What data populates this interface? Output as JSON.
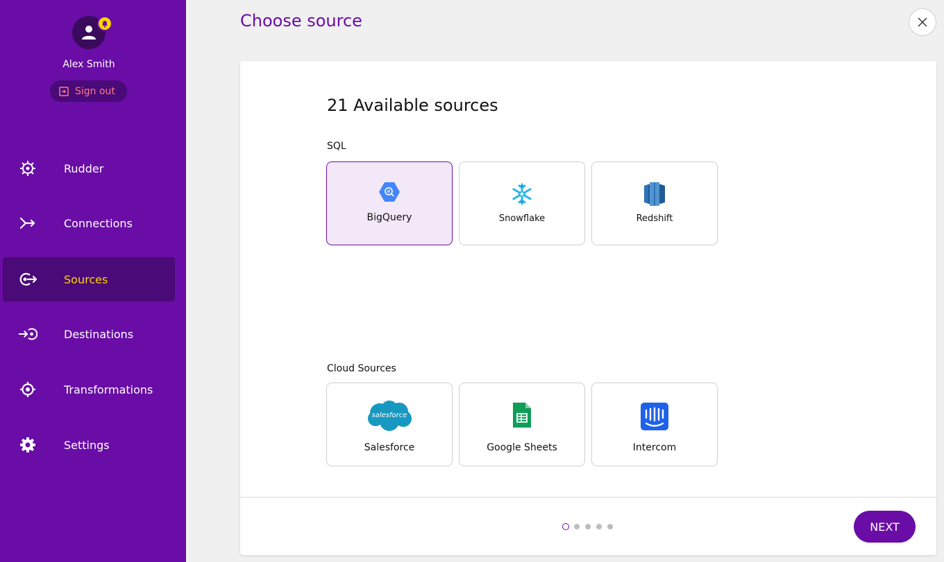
{
  "sidebar": {
    "user_name": "Alex Smith",
    "signout_label": "Sign out",
    "items": [
      {
        "label": "Rudder",
        "icon": "wheel-icon"
      },
      {
        "label": "Connections",
        "icon": "merge-arrow-icon"
      },
      {
        "label": "Sources",
        "icon": "source-icon"
      },
      {
        "label": "Destinations",
        "icon": "destination-icon"
      },
      {
        "label": "Transformations",
        "icon": "target-icon"
      },
      {
        "label": "Settings",
        "icon": "gear-icon"
      }
    ],
    "active_item": "Sources"
  },
  "header": {
    "title": "Choose source"
  },
  "main": {
    "heading": "21 Available sources",
    "sections": [
      {
        "label": "SQL",
        "tiles": [
          {
            "label": "BigQuery",
            "icon": "bigquery-icon",
            "selected": true
          },
          {
            "label": "Snowflake",
            "icon": "snowflake-icon",
            "selected": false
          },
          {
            "label": "Redshift",
            "icon": "redshift-icon",
            "selected": false
          }
        ]
      },
      {
        "label": "Cloud Sources",
        "tiles": [
          {
            "label": "Salesforce",
            "icon": "salesforce-icon",
            "selected": false
          },
          {
            "label": "Google Sheets",
            "icon": "google-sheets-icon",
            "selected": false
          },
          {
            "label": "Intercom",
            "icon": "intercom-icon",
            "selected": false
          }
        ]
      }
    ]
  },
  "footer": {
    "step_count": 5,
    "current_step": 1,
    "next_label": "NEXT"
  },
  "colors": {
    "sidebar_bg": "#6a0da6",
    "active_bg": "#4a0a78",
    "accent_yellow": "#ffd400",
    "signout_text": "#ff7a8a",
    "selected_tile_bg": "#f3e8f7"
  }
}
